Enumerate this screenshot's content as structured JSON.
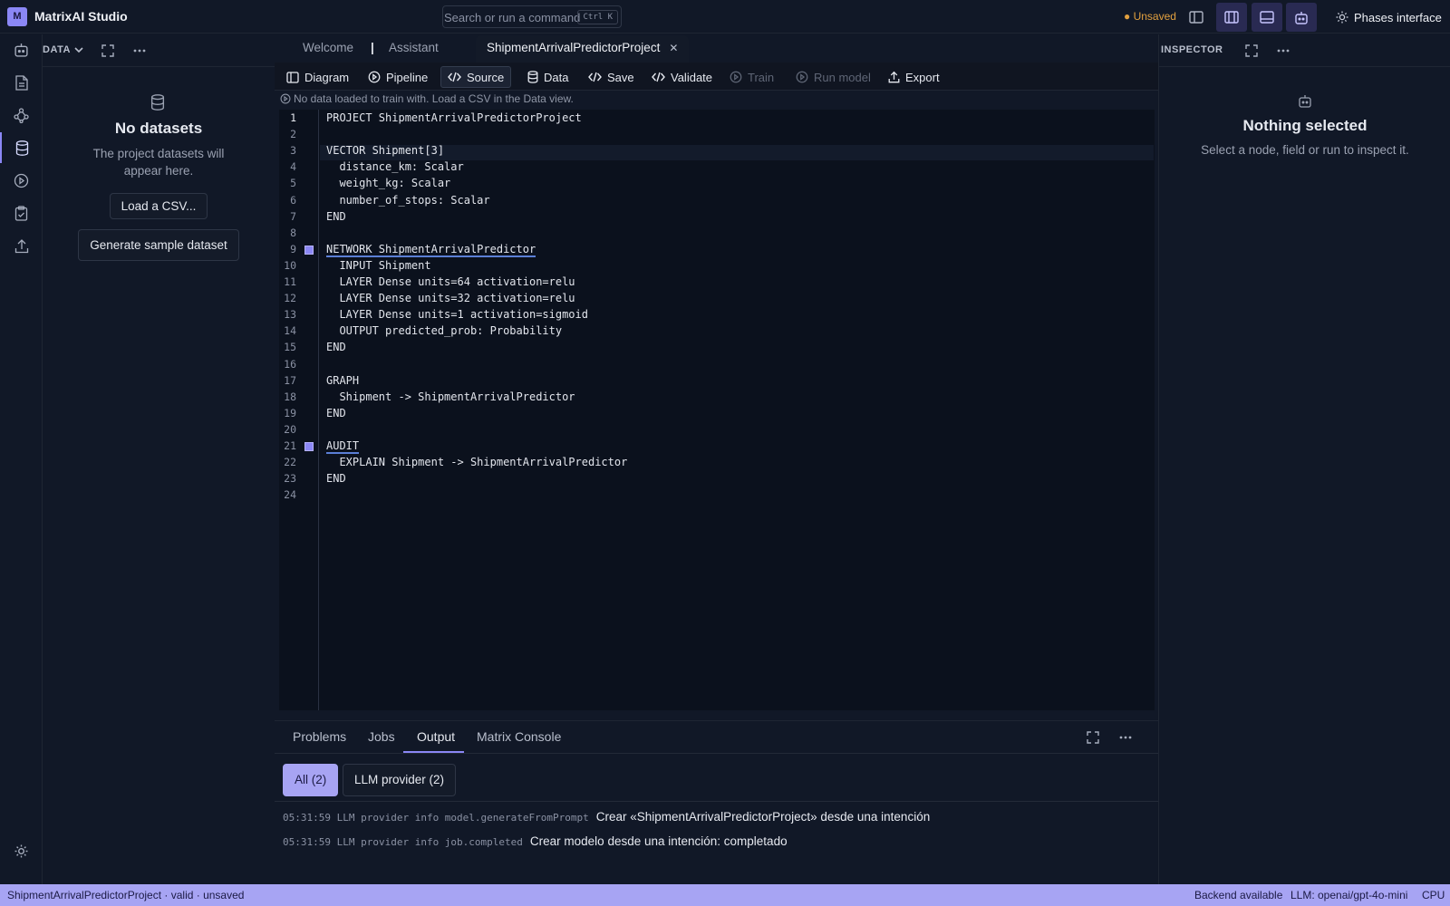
{
  "titlebar": {
    "logo_letter": "M",
    "app_title": "MatrixAI Studio",
    "search_placeholder": "Search or run a command",
    "search_shortcut": "Ctrl K",
    "unsaved_label": "● Unsaved",
    "phases_label": "Phases interface"
  },
  "left_panel": {
    "section_label": "DATA",
    "empty_title": "No datasets",
    "empty_hint_line1": "The project datasets will",
    "empty_hint_line2": "appear here.",
    "load_csv_label": "Load a CSV...",
    "generate_sample_label": "Generate sample dataset"
  },
  "tabs": {
    "welcome": "Welcome",
    "separator": "|",
    "assistant": "Assistant",
    "active": "ShipmentArrivalPredictorProject",
    "close_glyph": "✕"
  },
  "toolbar": {
    "diagram": "Diagram",
    "pipeline": "Pipeline",
    "source": "Source",
    "data": "Data",
    "save": "Save",
    "validate": "Validate",
    "train": "Train",
    "run_model": "Run model",
    "export": "Export"
  },
  "status_message": "No data loaded to train with. Load a CSV in the Data view.",
  "editor": {
    "line_numbers": [
      "1",
      "2",
      "3",
      "4",
      "5",
      "6",
      "7",
      "8",
      "9",
      "10",
      "11",
      "12",
      "13",
      "14",
      "15",
      "16",
      "17",
      "18",
      "19",
      "20",
      "21",
      "22",
      "23",
      "24"
    ],
    "lines": [
      "PROJECT ShipmentArrivalPredictorProject",
      "",
      "VECTOR Shipment[3]",
      "  distance_km: Scalar",
      "  weight_kg: Scalar",
      "  number_of_stops: Scalar",
      "END",
      "",
      "NETWORK ShipmentArrivalPredictor",
      "  INPUT Shipment",
      "  LAYER Dense units=64 activation=relu",
      "  LAYER Dense units=32 activation=relu",
      "  LAYER Dense units=1 activation=sigmoid",
      "  OUTPUT predicted_prob: Probability",
      "END",
      "",
      "GRAPH",
      "  Shipment -> ShipmentArrivalPredictor",
      "END",
      "",
      "AUDIT",
      "  EXPLAIN Shipment -> ShipmentArrivalPredictor",
      "END",
      ""
    ]
  },
  "bottom_panel": {
    "tabs": [
      "Problems",
      "Jobs",
      "Output",
      "Matrix Console"
    ],
    "filter_all": "All (2)",
    "filter_llm": "LLM provider (2)",
    "logs": [
      {
        "meta": "05:31:59 LLM provider info model.generateFromPrompt",
        "message": "Crear «ShipmentArrivalPredictorProject» desde una intención"
      },
      {
        "meta": "05:31:59 LLM provider info job.completed",
        "message": "Crear modelo desde una intención: completado"
      }
    ]
  },
  "inspector": {
    "title": "INSPECTOR",
    "empty_title": "Nothing selected",
    "empty_hint": "Select a node, field or run to inspect it."
  },
  "statusbar": {
    "left": "ShipmentArrivalPredictorProject · valid · unsaved",
    "backend": "Backend available",
    "llm": "LLM: openai/gpt-4o-mini",
    "device": "CPU"
  },
  "colors": {
    "accent": "#8b87f5",
    "statusbar_bg": "#a7a4f3",
    "unsaved": "#e2a03f",
    "background": "#111827",
    "editor_bg": "#0b111d"
  }
}
